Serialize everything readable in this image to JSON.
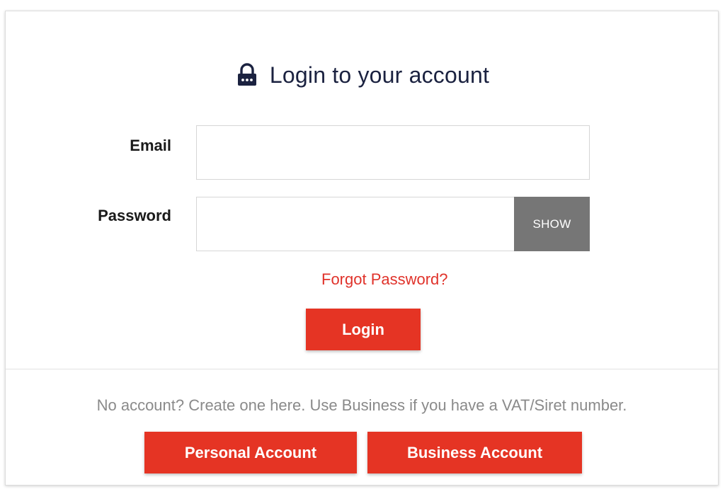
{
  "heading": {
    "icon": "lock-icon",
    "title": "Login to your account"
  },
  "form": {
    "email_label": "Email",
    "email_value": "",
    "email_placeholder": "",
    "password_label": "Password",
    "password_value": "",
    "password_placeholder": "",
    "show_label": "SHOW",
    "forgot_label": "Forgot Password?",
    "login_label": "Login"
  },
  "signup": {
    "note": "No account? Create one here. Use Business if you have a VAT/Siret number.",
    "personal_label": "Personal Account",
    "business_label": "Business Account"
  },
  "colors": {
    "accent": "#e53424",
    "title": "#1b2240",
    "show_button": "#767676",
    "muted_text": "#8a8a8a"
  }
}
